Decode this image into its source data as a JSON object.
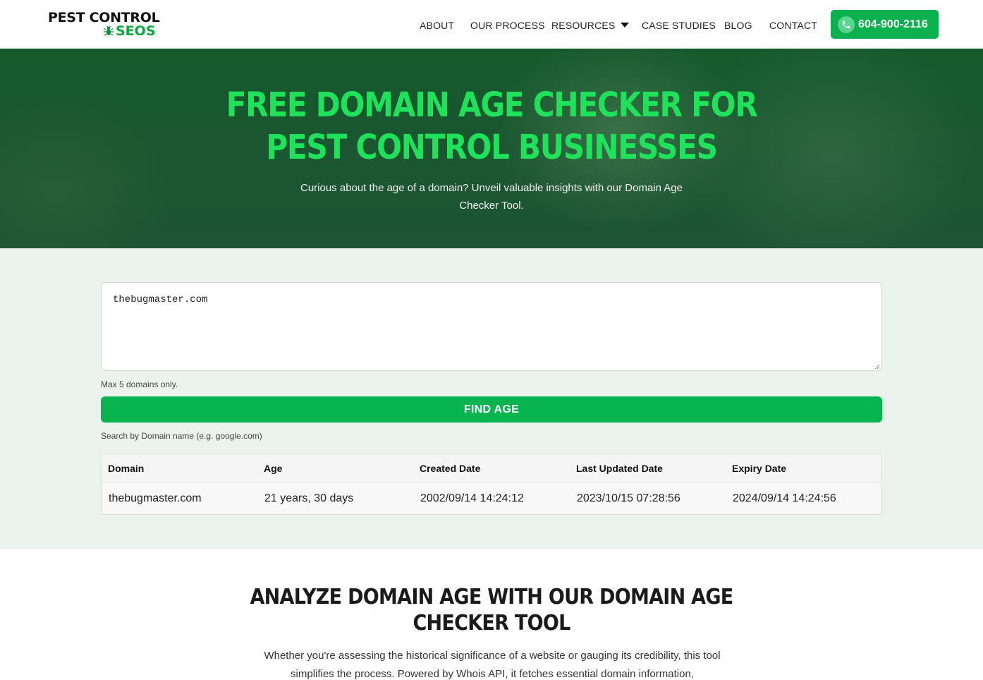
{
  "header": {
    "logo_line1": "PEST CONTROL",
    "logo_line2": "SEOS",
    "nav": {
      "about": "ABOUT",
      "our_process": "OUR PROCESS",
      "resources": "RESOURCES",
      "case_studies": "CASE STUDIES",
      "blog": "BLOG",
      "contact": "CONTACT"
    },
    "phone": "604-900-2116"
  },
  "hero": {
    "title_line1": "FREE DOMAIN AGE CHECKER FOR",
    "title_line2": "PEST CONTROL BUSINESSES",
    "subtitle": "Curious about the age of a domain? Unveil valuable insights with our Domain Age Checker Tool."
  },
  "tool": {
    "textarea_value": "thebugmaster.com",
    "max_hint": "Max 5 domains only.",
    "find_button": "FIND AGE",
    "search_hint": "Search by Domain name (e.g. google.com)",
    "columns": [
      "Domain",
      "Age",
      "Created Date",
      "Last Updated Date",
      "Expiry Date"
    ],
    "rows": [
      [
        "thebugmaster.com",
        "21 years, 30 days",
        "2002/09/14 14:24:12",
        "2023/10/15 07:28:56",
        "2024/09/14 14:24:56"
      ]
    ]
  },
  "analyze": {
    "title_line1": "ANALYZE DOMAIN AGE WITH OUR DOMAIN AGE",
    "title_line2": "CHECKER TOOL",
    "body": "Whether you're assessing the historical significance of a website or gauging its credibility, this tool simplifies the process. Powered by Whois API, it fetches essential domain information,"
  },
  "colors": {
    "brand_green": "#0cb14f",
    "hero_title_green": "#1fe25a",
    "hero_bg": "#165a2c",
    "tool_bg": "#ecf3ee"
  },
  "icons": [
    "bug-icon",
    "chevron-down-icon",
    "phone-icon",
    "resize-grip-icon"
  ]
}
